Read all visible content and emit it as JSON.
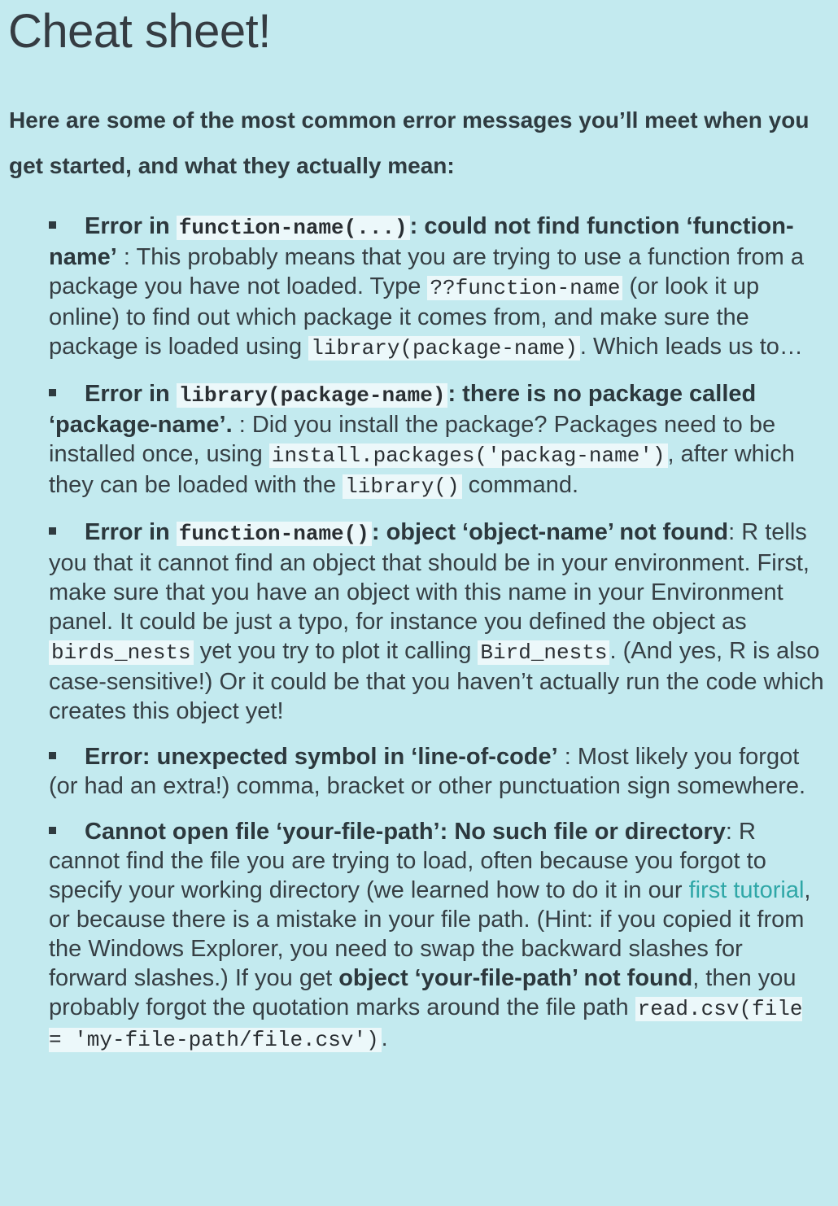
{
  "title": "Cheat sheet!",
  "intro": "Here are some of the most common error messages you’ll meet when you get started, and what they actually mean:",
  "items": [
    {
      "h1": "Error in ",
      "hcode": "function-name(...)",
      "h2": ": could not find function ‘function-name’",
      "t1": " : This probably means that you are trying to use a function from a package you have not loaded. Type ",
      "c1": "??function-name",
      "t2": " (or look it up online) to find out which package it comes from, and make sure the package is loaded using ",
      "c2": "library(package-name)",
      "t3": ". Which leads us to…"
    },
    {
      "h1": "Error in ",
      "hcode": "library(package-name)",
      "h2": ": there is no package called ‘package-name’.",
      "t1": " : Did you install the package? Packages need to be installed once, using ",
      "c1": "install.packages('packag-name')",
      "t2": ", after which they can be loaded with the ",
      "c2": "library()",
      "t3": " command."
    },
    {
      "h1": "Error in ",
      "hcode": "function-name()",
      "h2": ": object ‘object-name’ not found",
      "t1": ": R tells you that it cannot find an object that should be in your environment. First, make sure that you have an object with this name in your Environment panel. It could be just a typo, for instance you defined the object as ",
      "c1": "birds_nests",
      "t2": " yet you try to plot it calling ",
      "c2": "Bird_nests",
      "t3": ". (And yes, R is also case-sensitive!) Or it could be that you haven’t actually run the code which creates this object yet!"
    },
    {
      "h": "Error: unexpected symbol in ‘line-of-code’",
      "t1": " : Most likely you forgot (or had an extra!) comma, bracket or other punctuation sign somewhere."
    },
    {
      "h": "Cannot open file ‘your-file-path’: No such file or directory",
      "t1": ": R cannot find the file you are trying to load, often because you forgot to specify your working directory (we learned how to do it in our ",
      "link": "first tutorial",
      "t2": ", or because there is a mistake in your file path. (Hint: if you copied it from the Windows Explorer, you need to swap the backward slashes for forward slashes.) If you get ",
      "b2": "object ‘your-file-path’ not found",
      "t3": ", then you probably forgot the quotation marks around the file path ",
      "c1": "read.csv(file = 'my-file-path/file.csv')",
      "t4": "."
    }
  ]
}
